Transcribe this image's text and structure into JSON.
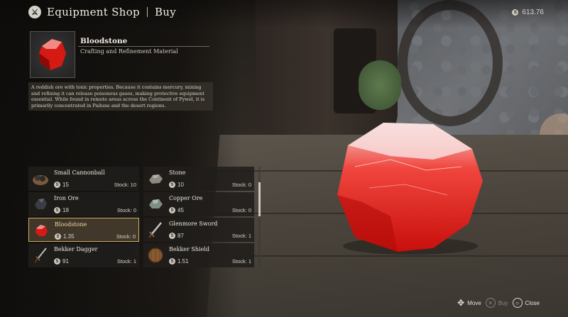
{
  "header": {
    "icon": "shop-emblem-icon",
    "title": "Equipment Shop",
    "mode": "Buy"
  },
  "currency": {
    "icon": "silver-coin-icon",
    "amount": "613.76"
  },
  "detail": {
    "name": "Bloodstone",
    "category": "Crafting and Refinement Material",
    "description": "A reddish ore with toxic properties. Because it contains mercury, mining and refining it can release poisonous gases, making protective equipment essential. While found in remote areas across the Continent of Pywel, it is primarily concentrated in Pailune and the desert regions.",
    "thumb_icon": "bloodstone-icon"
  },
  "items": [
    {
      "name": "Small Cannonball",
      "price": "15",
      "stock_label": "Stock:",
      "stock": "10",
      "icon": "cannonball-icon"
    },
    {
      "name": "Stone",
      "price": "10",
      "stock_label": "Stock:",
      "stock": "0",
      "icon": "stone-icon"
    },
    {
      "name": "Iron Ore",
      "price": "18",
      "stock_label": "Stock:",
      "stock": "0",
      "icon": "iron-ore-icon"
    },
    {
      "name": "Copper Ore",
      "price": "45",
      "stock_label": "Stock:",
      "stock": "0",
      "icon": "copper-ore-icon"
    },
    {
      "name": "Bloodstone",
      "price": "1.35",
      "stock_label": "Stock:",
      "stock": "0",
      "icon": "bloodstone-icon",
      "selected": true
    },
    {
      "name": "Glenmore Sword",
      "price": "87",
      "stock_label": "Stock:",
      "stock": "1",
      "icon": "sword-icon"
    },
    {
      "name": "Bekker Dagger",
      "price": "91",
      "stock_label": "Stock:",
      "stock": "1",
      "icon": "dagger-icon"
    },
    {
      "name": "Bekker Shield",
      "price": "1.51",
      "stock_label": "Stock:",
      "stock": "1",
      "icon": "shield-icon"
    }
  ],
  "hints": [
    {
      "label": "Move",
      "icon": "dpad-icon",
      "enabled": true
    },
    {
      "label": "Buy",
      "icon": "cross-button-icon",
      "enabled": false
    },
    {
      "label": "Close",
      "icon": "circle-button-icon",
      "enabled": true
    }
  ],
  "colors": {
    "selected_border": "#c9ac63",
    "bloodstone_red": "#e0201a"
  }
}
